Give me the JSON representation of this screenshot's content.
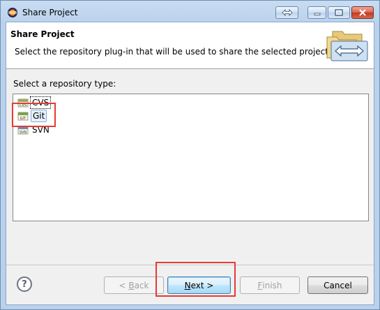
{
  "window": {
    "title": "Share Project"
  },
  "header": {
    "title": "Share Project",
    "description": "Select the repository plug-in that will be used to share the selected project."
  },
  "repository": {
    "label": "Select a repository type:",
    "items": [
      {
        "label": "CVS",
        "icon": "cvs-icon",
        "icon_text": "CVS"
      },
      {
        "label": "Git",
        "icon": "git-icon",
        "icon_text": "GIT",
        "selected": true
      },
      {
        "label": "SVN",
        "icon": "svn-icon",
        "icon_text": "SVN"
      }
    ]
  },
  "buttons": {
    "back_mnemonic": "B",
    "back_rest": "ack",
    "back_prefix": "< ",
    "next_mnemonic": "N",
    "next_rest": "ext >",
    "finish_mnemonic": "F",
    "finish_rest": "inish",
    "cancel": "Cancel",
    "help_glyph": "?"
  },
  "colors": {
    "annotation": "#e23c34",
    "titlebar": "#b9d1ec",
    "close_button": "#c1361f"
  }
}
